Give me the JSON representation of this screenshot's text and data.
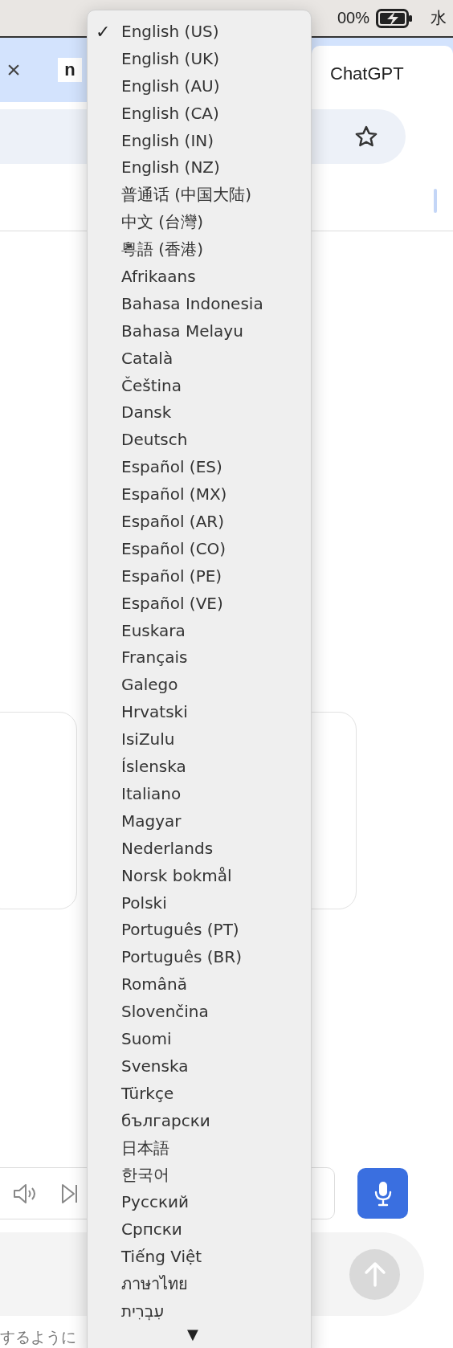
{
  "menu_bar": {
    "battery_text": "00%",
    "clock_fragment": "水"
  },
  "tab_strip": {
    "close_glyph": "×",
    "favicon_letter": "n",
    "tab_title": "ChatGPT"
  },
  "language_menu": {
    "check_mark": "✓",
    "scroll_arrow": "▼",
    "items": [
      {
        "label": "English (US)",
        "selected": true
      },
      {
        "label": "English (UK)",
        "selected": false
      },
      {
        "label": "English (AU)",
        "selected": false
      },
      {
        "label": "English (CA)",
        "selected": false
      },
      {
        "label": "English (IN)",
        "selected": false
      },
      {
        "label": "English (NZ)",
        "selected": false
      },
      {
        "label": "普通话 (中国大陆)",
        "selected": false
      },
      {
        "label": "中文 (台灣)",
        "selected": false
      },
      {
        "label": "粵語 (香港)",
        "selected": false
      },
      {
        "label": "Afrikaans",
        "selected": false
      },
      {
        "label": "Bahasa Indonesia",
        "selected": false
      },
      {
        "label": "Bahasa Melayu",
        "selected": false
      },
      {
        "label": "Català",
        "selected": false
      },
      {
        "label": "Čeština",
        "selected": false
      },
      {
        "label": "Dansk",
        "selected": false
      },
      {
        "label": "Deutsch",
        "selected": false
      },
      {
        "label": "Español (ES)",
        "selected": false
      },
      {
        "label": "Español (MX)",
        "selected": false
      },
      {
        "label": "Español (AR)",
        "selected": false
      },
      {
        "label": "Español (CO)",
        "selected": false
      },
      {
        "label": "Español (PE)",
        "selected": false
      },
      {
        "label": "Español (VE)",
        "selected": false
      },
      {
        "label": "Euskara",
        "selected": false
      },
      {
        "label": "Français",
        "selected": false
      },
      {
        "label": "Galego",
        "selected": false
      },
      {
        "label": "Hrvatski",
        "selected": false
      },
      {
        "label": "IsiZulu",
        "selected": false
      },
      {
        "label": "Íslenska",
        "selected": false
      },
      {
        "label": "Italiano",
        "selected": false
      },
      {
        "label": "Magyar",
        "selected": false
      },
      {
        "label": "Nederlands",
        "selected": false
      },
      {
        "label": "Norsk bokmål",
        "selected": false
      },
      {
        "label": "Polski",
        "selected": false
      },
      {
        "label": "Português (PT)",
        "selected": false
      },
      {
        "label": "Português (BR)",
        "selected": false
      },
      {
        "label": "Română",
        "selected": false
      },
      {
        "label": "Slovenčina",
        "selected": false
      },
      {
        "label": "Suomi",
        "selected": false
      },
      {
        "label": "Svenska",
        "selected": false
      },
      {
        "label": "Türkçe",
        "selected": false
      },
      {
        "label": "български",
        "selected": false
      },
      {
        "label": "日本語",
        "selected": false
      },
      {
        "label": "한국어",
        "selected": false
      },
      {
        "label": "Русский",
        "selected": false
      },
      {
        "label": "Српски",
        "selected": false
      },
      {
        "label": "Tiếng Việt",
        "selected": false
      },
      {
        "label": "ภาษาไทย",
        "selected": false
      },
      {
        "label": "עִבְרִית",
        "selected": false
      }
    ]
  },
  "footer": {
    "text": "するように"
  }
}
